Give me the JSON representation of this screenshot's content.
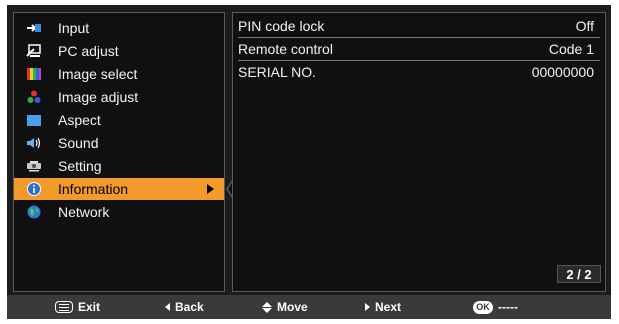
{
  "menu": {
    "items": [
      {
        "label": "Input",
        "icon": "input-icon",
        "active": false
      },
      {
        "label": "PC adjust",
        "icon": "pc-adjust-icon",
        "active": false
      },
      {
        "label": "Image select",
        "icon": "image-select-icon",
        "active": false
      },
      {
        "label": "Image adjust",
        "icon": "image-adjust-icon",
        "active": false
      },
      {
        "label": "Aspect",
        "icon": "aspect-icon",
        "active": false
      },
      {
        "label": "Sound",
        "icon": "speaker-icon",
        "active": false
      },
      {
        "label": "Setting",
        "icon": "setting-icon",
        "active": false
      },
      {
        "label": "Information",
        "icon": "info-icon",
        "active": true
      },
      {
        "label": "Network",
        "icon": "globe-icon",
        "active": false
      }
    ],
    "active_color": "#f29a2c"
  },
  "panel": {
    "rows": [
      {
        "label": "PIN code lock",
        "value": "Off"
      },
      {
        "label": "Remote control",
        "value": "Code 1"
      },
      {
        "label": "SERIAL NO.",
        "value": "00000000"
      }
    ],
    "pager": "2 / 2"
  },
  "bottom_bar": {
    "exit": "Exit",
    "back": "Back",
    "move": "Move",
    "next": "Next",
    "ok": "OK",
    "ok_value": "-----"
  }
}
